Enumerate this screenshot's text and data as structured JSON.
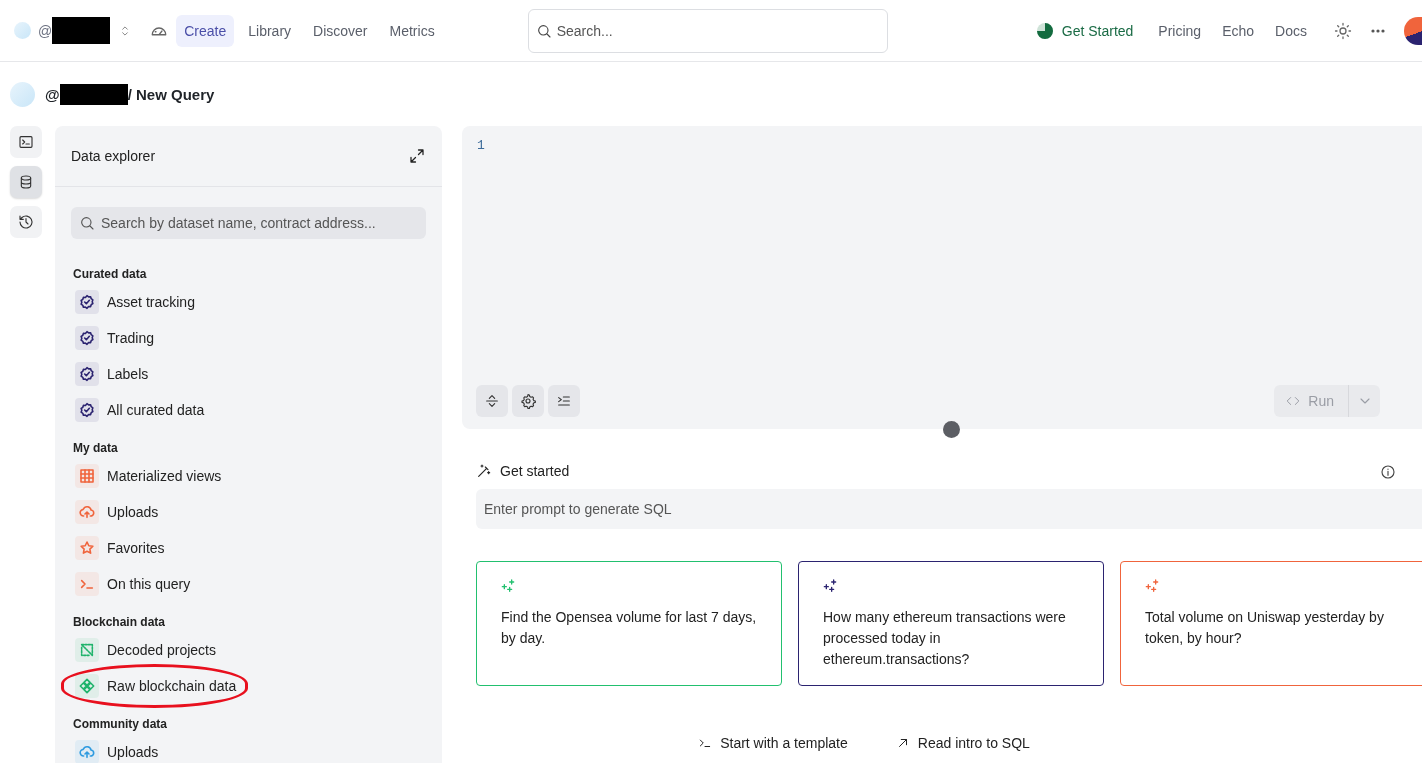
{
  "account": {
    "handle": "@",
    "redacted": true
  },
  "nav": [
    {
      "label": "Create",
      "selected": true
    },
    {
      "label": "Library",
      "selected": false
    },
    {
      "label": "Discover",
      "selected": false
    },
    {
      "label": "Metrics",
      "selected": false
    }
  ],
  "search": {
    "placeholder": "Search..."
  },
  "get_started": {
    "label": "Get Started"
  },
  "links": [
    "Pricing",
    "Echo",
    "Docs"
  ],
  "breadcrumb": {
    "owner": "@",
    "redacted": true,
    "title": "/ New Query"
  },
  "rail": [
    {
      "kind": "terminal",
      "selected": false
    },
    {
      "kind": "database",
      "selected": true
    },
    {
      "kind": "history",
      "selected": false
    }
  ],
  "explorer": {
    "title": "Data explorer",
    "search_placeholder": "Search by dataset name, contract address...",
    "groups": [
      {
        "title": "Curated data",
        "color": "#2b2370",
        "items": [
          {
            "label": "Asset tracking",
            "kind": "badge",
            "highlighted": false
          },
          {
            "label": "Trading",
            "kind": "badge",
            "highlighted": false
          },
          {
            "label": "Labels",
            "kind": "badge",
            "highlighted": false
          },
          {
            "label": "All curated data",
            "kind": "badge",
            "highlighted": false
          }
        ]
      },
      {
        "title": "My data",
        "color": "#f0643c",
        "items": [
          {
            "label": "Materialized views",
            "kind": "grid",
            "highlighted": false
          },
          {
            "label": "Uploads",
            "kind": "upload",
            "highlighted": false
          },
          {
            "label": "Favorites",
            "kind": "star",
            "highlighted": false
          },
          {
            "label": "On this query",
            "kind": "terminal",
            "highlighted": false
          }
        ]
      },
      {
        "title": "Blockchain data",
        "color": "#1fb36b",
        "items": [
          {
            "label": "Decoded projects",
            "kind": "decoded",
            "highlighted": false
          },
          {
            "label": "Raw blockchain data",
            "kind": "diamond",
            "highlighted": true
          }
        ]
      },
      {
        "title": "Community data",
        "color": "#2f9be0",
        "items": [
          {
            "label": "Uploads",
            "kind": "upload",
            "highlighted": false
          }
        ]
      }
    ]
  },
  "editor": {
    "line_numbers": [
      "1"
    ],
    "run": {
      "label": "Run",
      "disabled": true
    }
  },
  "prompt": {
    "title": "Get started",
    "placeholder": "Enter prompt to generate SQL"
  },
  "suggestions": [
    {
      "text": "Find the Opensea volume for last 7 days, by day.",
      "color": "#22c06f"
    },
    {
      "text": "How many ethereum transactions were processed today in ethereum.transactions?",
      "color": "#2b2370"
    },
    {
      "text": "Total volume on Uniswap yesterday by token, by hour?",
      "color": "#f0643c"
    }
  ],
  "footer_links": [
    {
      "label": "Start with a template",
      "kind": "terminal"
    },
    {
      "label": "Read intro to SQL",
      "kind": "arrow"
    }
  ]
}
